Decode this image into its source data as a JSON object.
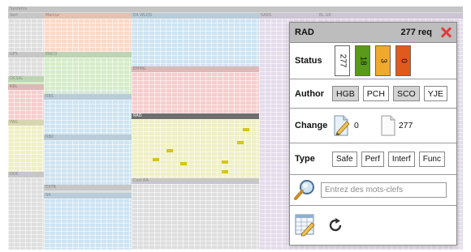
{
  "panel": {
    "title": "RAD",
    "req_label": "277 req",
    "status": {
      "label": "Status",
      "bars": [
        {
          "value": "277",
          "color": "#ffffff",
          "fraction": 0
        },
        {
          "value": "18",
          "color": "#5a9a1b",
          "fraction": 1
        },
        {
          "value": "3",
          "color": "#f0a92c",
          "fraction": 1
        },
        {
          "value": "0",
          "color": "#e05a1c",
          "fraction": 1
        }
      ]
    },
    "author": {
      "label": "Author",
      "buttons": [
        {
          "label": "HGB",
          "selected": true
        },
        {
          "label": "PCH",
          "selected": false
        },
        {
          "label": "SCO",
          "selected": true
        },
        {
          "label": "YJE",
          "selected": false
        }
      ]
    },
    "change": {
      "label": "Change",
      "edited_count": "0",
      "document_count": "277"
    },
    "type": {
      "label": "Type",
      "buttons": [
        "Safe",
        "Perf",
        "Interf",
        "Func"
      ]
    },
    "search": {
      "placeholder": "Entrez des mots-clefs"
    }
  },
  "treemap": {
    "regions": [
      {
        "label": "Systems",
        "color": "#dcdcdc"
      },
      {
        "label": "Sert",
        "color": "#dedede"
      },
      {
        "label": "Mercur",
        "color": "#fbd9c8"
      },
      {
        "label": "EA WLQS",
        "color": "#cfe4f1"
      },
      {
        "label": "SASS",
        "color": "#e4dceb"
      },
      {
        "label": "BL G6",
        "color": "#e4dceb"
      },
      {
        "label": "GFS",
        "color": "#dedede"
      },
      {
        "label": "OCSIG",
        "color": "#d4ecc8"
      },
      {
        "label": "ENCO",
        "color": "#d4ecc8"
      },
      {
        "label": "KBL",
        "color": "#f6cdcd"
      },
      {
        "label": "EMMG",
        "color": "#f6cdcd"
      },
      {
        "label": "RAD",
        "color": "#efefc6"
      },
      {
        "label": "RB1",
        "color": "#cfe4f1"
      },
      {
        "label": "PAG",
        "color": "#efefc6"
      },
      {
        "label": "RB2",
        "color": "#cfe4f1"
      },
      {
        "label": "DOC",
        "color": "#dedede"
      },
      {
        "label": "EXTR",
        "color": "#dedede"
      },
      {
        "label": "Cort RA",
        "color": "#dedede"
      },
      {
        "label": "S4",
        "color": "#cfe4f1"
      }
    ]
  }
}
